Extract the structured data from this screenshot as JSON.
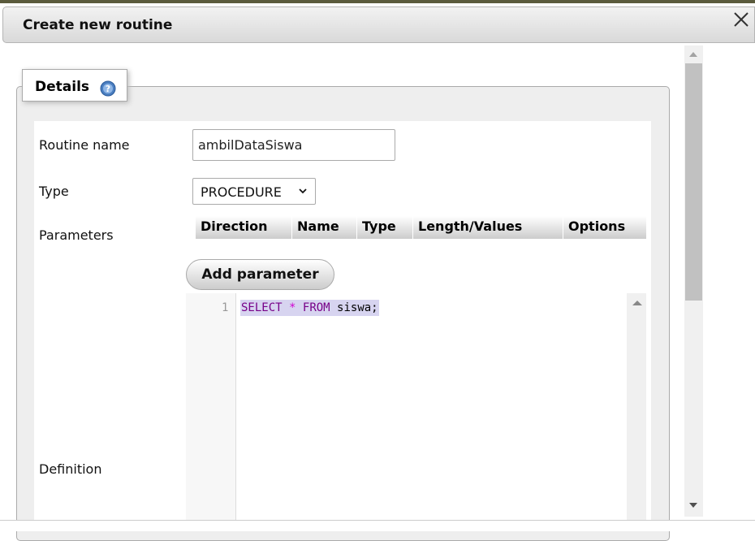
{
  "dialog": {
    "title": "Create new routine",
    "close_icon": "close-icon"
  },
  "details": {
    "legend": "Details",
    "help_icon": "help-icon"
  },
  "form": {
    "routine_name_label": "Routine name",
    "routine_name_value": "ambilDataSiswa",
    "type_label": "Type",
    "type_value": "PROCEDURE",
    "parameters_label": "Parameters",
    "definition_label": "Definition",
    "param_columns": [
      "Direction",
      "Name",
      "Type",
      "Length/Values",
      "Options"
    ],
    "add_parameter_label": "Add parameter"
  },
  "editor": {
    "line_number": "1",
    "code_tokens": [
      {
        "text": "SELECT",
        "kind": "keyword"
      },
      {
        "text": " ",
        "kind": "space"
      },
      {
        "text": "*",
        "kind": "operator"
      },
      {
        "text": " ",
        "kind": "space"
      },
      {
        "text": "FROM",
        "kind": "keyword"
      },
      {
        "text": " siswa;",
        "kind": "identifier"
      }
    ]
  },
  "colors": {
    "keyword": "#770088",
    "operator": "#d000d0",
    "selection": "#d7d4f0"
  }
}
